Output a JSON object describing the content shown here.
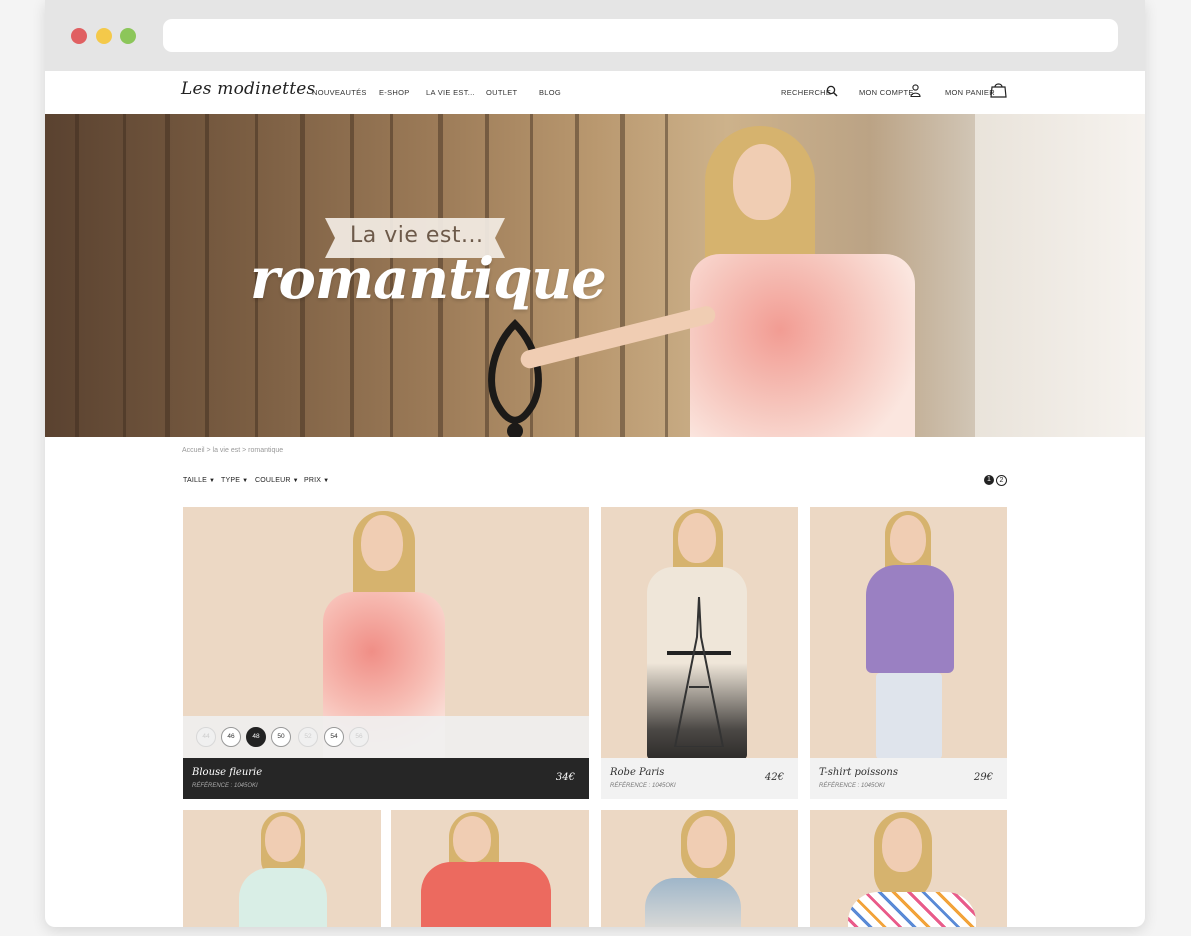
{
  "colors": {
    "dark_info_bar": "#262626",
    "photo_background": "#ecd8c4",
    "window_chrome": "#e5e5e5"
  },
  "header": {
    "logo": "Les modinettes",
    "nav": [
      "NOUVEAUTÉS",
      "E-SHOP",
      "LA VIE EST...",
      "OUTLET",
      "BLOG"
    ],
    "search_label": "RECHERCHE",
    "account_label": "MON COMPTE",
    "cart_label": "MON PANIER",
    "icons": [
      "search-icon",
      "user-icon",
      "cart-icon"
    ]
  },
  "hero": {
    "banner_text": "La vie est...",
    "script_text": "romantique"
  },
  "breadcrumb": "Accueil > la vie est > romantique",
  "filters": [
    "TAILLE",
    "TYPE",
    "COULEUR",
    "PRIX"
  ],
  "pagination": [
    "1",
    "2"
  ],
  "sizes": [
    "44",
    "46",
    "48",
    "50",
    "52",
    "54",
    "56"
  ],
  "products": [
    {
      "name": "Blouse fleurie",
      "ref": "RÉFÉRENCE : 1045OKI",
      "price": "34€"
    },
    {
      "name": "Robe Paris",
      "ref": "RÉFÉRENCE : 1045OKI",
      "price": "42€"
    },
    {
      "name": "T-shirt poissons",
      "ref": "RÉFÉRENCE : 1045OKI",
      "price": "29€"
    }
  ]
}
